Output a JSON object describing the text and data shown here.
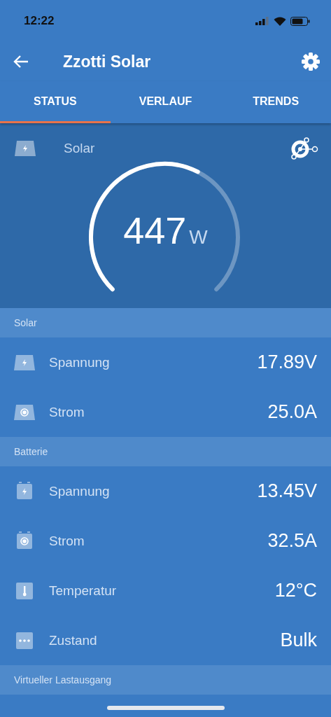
{
  "status_bar": {
    "time": "12:22"
  },
  "app_bar": {
    "title": "Zzotti Solar"
  },
  "tabs": [
    {
      "label": "STATUS",
      "selected": true
    },
    {
      "label": "VERLAUF",
      "selected": false
    },
    {
      "label": "TRENDS",
      "selected": false
    }
  ],
  "gauge": {
    "label": "Solar",
    "value": "447",
    "unit": "W"
  },
  "sections": [
    {
      "title": "Solar",
      "rows": [
        {
          "kind": "panel-voltage",
          "label": "Spannung",
          "value": "17.89V"
        },
        {
          "kind": "panel-current",
          "label": "Strom",
          "value": "25.0A"
        }
      ]
    },
    {
      "title": "Batterie",
      "rows": [
        {
          "kind": "battery-voltage",
          "label": "Spannung",
          "value": "13.45V"
        },
        {
          "kind": "battery-current",
          "label": "Strom",
          "value": "32.5A"
        },
        {
          "kind": "temperature",
          "label": "Temperatur",
          "value": "12°C"
        },
        {
          "kind": "state",
          "label": "Zustand",
          "value": "Bulk"
        }
      ]
    },
    {
      "title": "Virtueller Lastausgang"
    }
  ]
}
